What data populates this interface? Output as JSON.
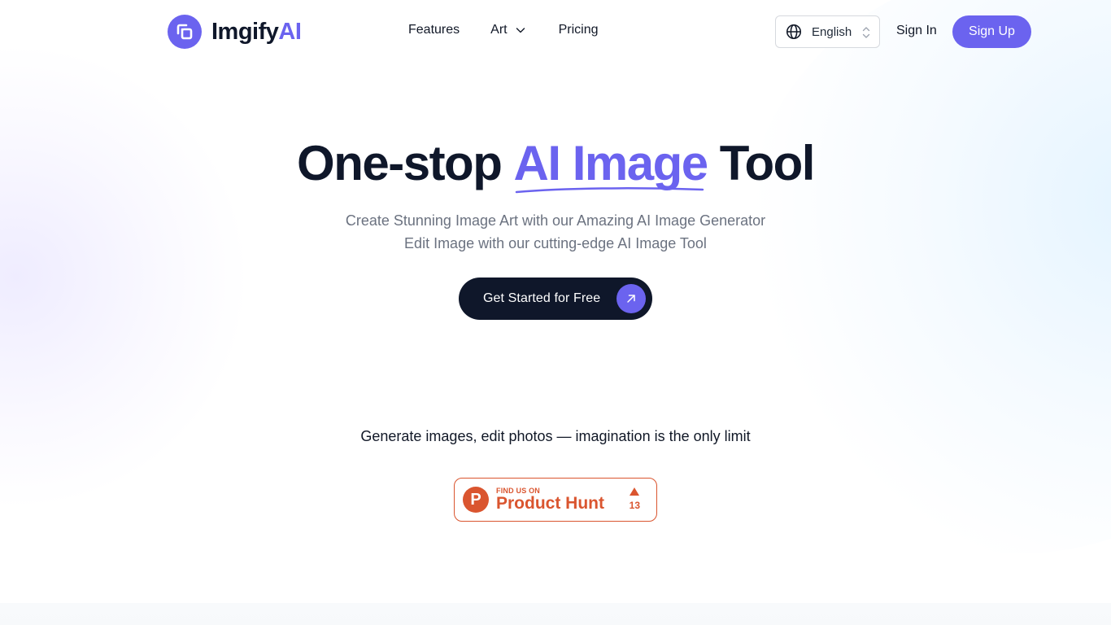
{
  "brand": {
    "name_main": "Imgify",
    "name_accent": "AI",
    "accent_color": "#6b63ef",
    "logo_icon": "stacked-squares-icon"
  },
  "nav": {
    "links": [
      {
        "label": "Features"
      },
      {
        "label": "Art",
        "has_dropdown": true
      },
      {
        "label": "Pricing"
      }
    ],
    "language": {
      "icon": "globe-icon",
      "selected": "English"
    },
    "sign_in": "Sign In",
    "sign_up": "Sign Up"
  },
  "hero": {
    "title_before": "One-stop ",
    "title_accent": "AI Image",
    "title_after": " Tool",
    "subtitle_line1": "Create Stunning Image Art with our Amazing AI Image Generator",
    "subtitle_line2": "Edit Image with our cutting-edge AI Image Tool",
    "cta_label": "Get Started for Free",
    "cta_icon": "arrow-up-right-icon",
    "tagline": "Generate images, edit photos — imagination is the only limit"
  },
  "product_hunt": {
    "small_label": "FIND US ON",
    "big_label": "Product Hunt",
    "logo_letter": "P",
    "votes": "13",
    "color": "#da552f"
  }
}
